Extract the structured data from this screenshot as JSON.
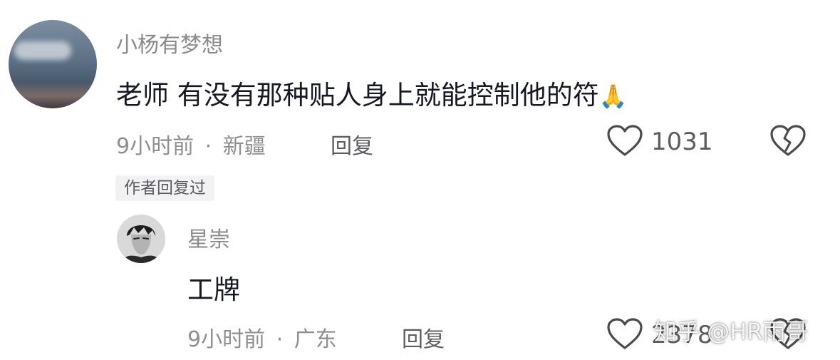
{
  "comment": {
    "username": "小杨有梦想",
    "text": "老师 有没有那种贴人身上就能控制他的符",
    "emoji": "🙏",
    "time": "9小时前",
    "separator": "·",
    "location": "新疆",
    "reply_label": "回复",
    "like_count": "1031",
    "author_replied_tag": "作者回复过"
  },
  "reply": {
    "username": "星崇",
    "text": "工牌",
    "time": "9小时前",
    "separator": "·",
    "location": "广东",
    "reply_label": "回复",
    "like_count": "2378"
  },
  "watermark": "知乎 @HR雨哥",
  "icons": {
    "like": "heart-outline-icon",
    "dislike": "broken-heart-icon"
  }
}
